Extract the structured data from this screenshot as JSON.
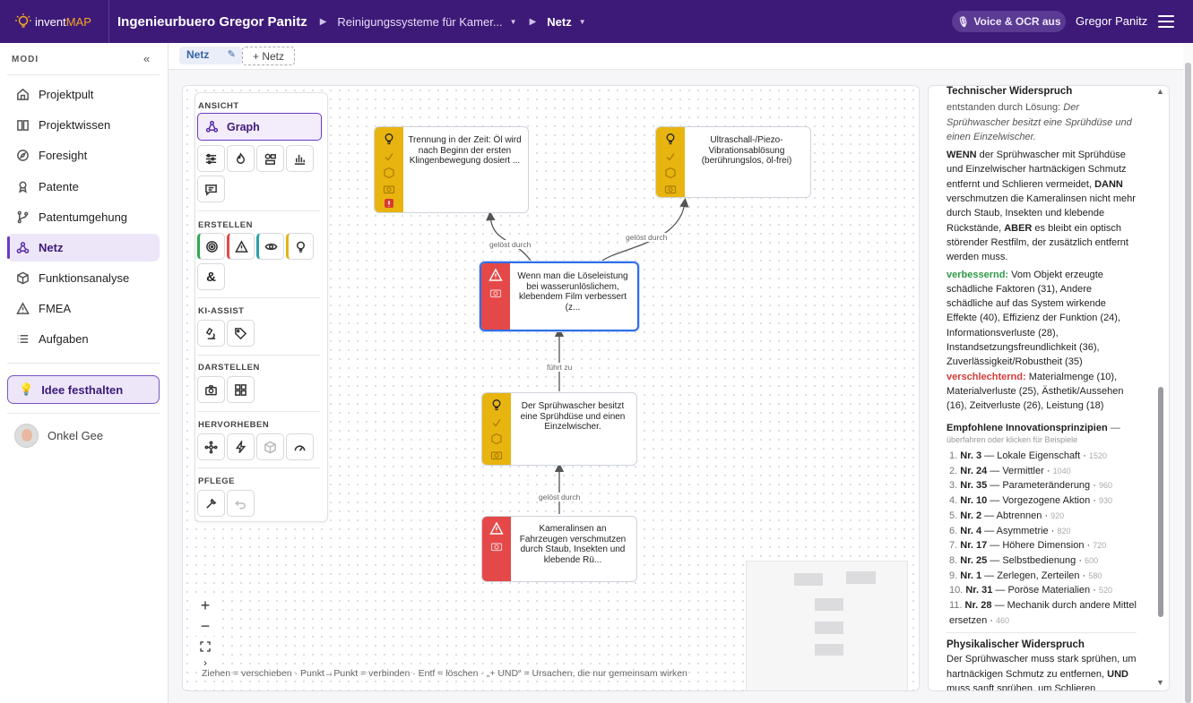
{
  "topbar": {
    "logo_part1": "invent",
    "logo_part2": "MAP",
    "project": "Ingenieurbuero Gregor Panitz",
    "breadcrumb_1": "Reinigungssysteme für Kamer...",
    "breadcrumb_2": "Netz",
    "voice_button": "Voice & OCR aus",
    "user": "Gregor Panitz"
  },
  "sidebar": {
    "header": "MODI",
    "collapse": "«",
    "items": [
      {
        "label": "Projektpult",
        "icon": "home-icon"
      },
      {
        "label": "Projektwissen",
        "icon": "book-icon"
      },
      {
        "label": "Foresight",
        "icon": "compass-icon"
      },
      {
        "label": "Patente",
        "icon": "ribbon-icon"
      },
      {
        "label": "Patentumgehung",
        "icon": "branch-icon"
      },
      {
        "label": "Netz",
        "icon": "network-icon"
      },
      {
        "label": "Funktionsanalyse",
        "icon": "cube-icon"
      },
      {
        "label": "FMEA",
        "icon": "warning-icon"
      },
      {
        "label": "Aufgaben",
        "icon": "list-icon"
      }
    ],
    "idee": "Idee festhalten",
    "account": "Onkel Gee"
  },
  "tabs": {
    "active": "Netz",
    "add": "+ Netz"
  },
  "tools": {
    "ansicht": "ANSICHT",
    "graph": "Graph",
    "erstellen": "ERSTELLEN",
    "ki_assist": "KI-ASSIST",
    "darstellen": "DARSTELLEN",
    "hervorheben": "HERVORHEBEN",
    "pflege": "PFLEGE",
    "amp": "&"
  },
  "canvas": {
    "hint": "Ziehen = verschieben · Punkt→Punkt = verbinden · Entf = löschen · „+ UND“ = Ursachen, die nur gemeinsam wirken",
    "zoom_in": "+",
    "zoom_out": "−",
    "nodes": [
      {
        "id": "n1",
        "text": "Trennung in der Zeit: Öl wird nach Beginn der ersten Klingenbewegung dosiert ..."
      },
      {
        "id": "n2",
        "text": "Ultraschall-/Piezo-Vibrationsablösung (berührungslos, öl-frei)"
      },
      {
        "id": "n3",
        "text": "Wenn man die Löseleistung bei wasserunlöslichem, klebendem Film verbessert (z..."
      },
      {
        "id": "n4",
        "text": "Der Sprühwascher besitzt eine Sprühdüse und einen Einzelwischer."
      },
      {
        "id": "n5",
        "text": "Kameralinsen an Fahrzeugen verschmutzen durch Staub, Insekten und klebende Rü..."
      }
    ],
    "edge_labels": {
      "e1": "gelöst durch",
      "e2": "gelöst durch",
      "e3": "führt zu",
      "e4": "gelöst durch"
    }
  },
  "panel": {
    "title": "Technischer Widerspruch",
    "origin_prefix": "entstanden durch Lösung: ",
    "origin_text": "Der Sprühwascher besitzt eine Sprühdüse und einen Einzelwischer.",
    "wenn": "WENN",
    "wenn_text": " der Sprühwascher mit Sprühdüse und Einzelwischer hartnäckigen Schmutz entfernt und Schlieren vermeidet, ",
    "dann": "DANN",
    "dann_text": " verschmutzen die Kameralinsen nicht mehr durch Staub, Insekten und klebende Rückstände, ",
    "aber": "ABER",
    "aber_text": " es bleibt ein optisch störender Restfilm, der zusätzlich entfernt werden muss.",
    "verbessernd_label": "verbessernd:",
    "verbessernd_text": " Vom Objekt erzeugte schädliche Faktoren (31), Andere schädliche auf das System wirkende Effekte (40), Effizienz der Funktion (24), Informationsverluste (28), Instandsetzungsfreundlichkeit (36), Zuverlässigkeit/Robustheit (35)",
    "verschlechternd_label": "verschlechternd:",
    "verschlechternd_text": " Materialmenge (10), Materialverluste (25), Ästhetik/Aussehen (16), Zeitverluste (26), Leistung (18)",
    "principles_title": "Empfohlene Innovationsprinzipien",
    "principles_dash": " —",
    "principles_sub": "überfahren oder klicken für Beispiele",
    "principles": [
      {
        "pos": "1.",
        "nr": "Nr. 3",
        "name": " — Lokale Eigenschaft",
        "count": "1520"
      },
      {
        "pos": "2.",
        "nr": "Nr. 24",
        "name": " — Vermittler",
        "count": "1040"
      },
      {
        "pos": "3.",
        "nr": "Nr. 35",
        "name": " — Parameteränderung",
        "count": "960"
      },
      {
        "pos": "4.",
        "nr": "Nr. 10",
        "name": " — Vorgezogene Aktion",
        "count": "930"
      },
      {
        "pos": "5.",
        "nr": "Nr. 2",
        "name": " — Abtrennen",
        "count": "920"
      },
      {
        "pos": "6.",
        "nr": "Nr. 4",
        "name": " — Asymmetrie",
        "count": "820"
      },
      {
        "pos": "7.",
        "nr": "Nr. 17",
        "name": " — Höhere Dimension",
        "count": "720"
      },
      {
        "pos": "8.",
        "nr": "Nr. 25",
        "name": " — Selbstbedienung",
        "count": "600"
      },
      {
        "pos": "9.",
        "nr": "Nr. 1",
        "name": " — Zerlegen, Zerteilen",
        "count": "580"
      },
      {
        "pos": "10.",
        "nr": "Nr. 31",
        "name": " — Poröse Materialien",
        "count": "520"
      },
      {
        "pos": "11.",
        "nr": "Nr. 28",
        "name": " — Mechanik durch andere Mittel ersetzen",
        "count": "460"
      }
    ],
    "phys_title": "Physikalischer Widerspruch",
    "phys_text": "Der Sprühwascher muss stark sprühen, um hartnäckigen Schmutz zu entfernen,",
    "phys_und": "UND",
    "phys_text2": " muss sanft sprühen, um Schlieren"
  },
  "colors": {
    "topbar": "#3d1a78",
    "accent": "#6a3bbd",
    "idea_node": "#e8b40f",
    "problem_node": "#e54848",
    "selected": "#2f6ee8"
  }
}
